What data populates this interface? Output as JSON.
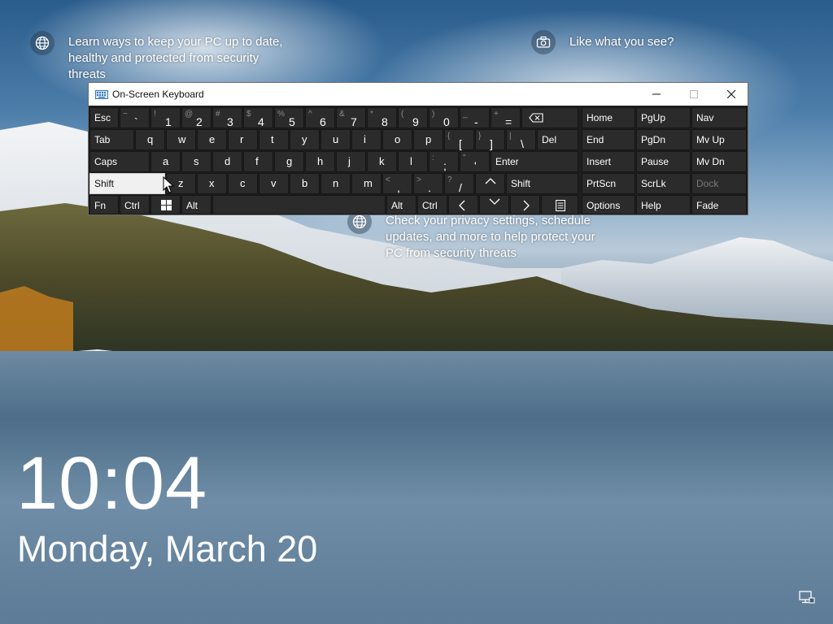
{
  "notifications": [
    {
      "icon": "globe-icon",
      "text_lines": [
        "Learn ways to keep your PC up to date,",
        "healthy and protected from security",
        "threats"
      ]
    },
    {
      "icon": "camera-icon",
      "text_lines": [
        "Like what you see?"
      ]
    },
    {
      "icon": "globe-icon",
      "text_lines": [
        "Check your privacy settings, schedule",
        "updates, and more to help protect your",
        "PC from security threats"
      ]
    }
  ],
  "lock_screen": {
    "time": "10:04",
    "date": "Monday, March 20"
  },
  "osk": {
    "title": "On-Screen Keyboard",
    "rows": [
      [
        {
          "label": "Esc"
        },
        {
          "shift": "~",
          "base": "`"
        },
        {
          "shift": "!",
          "base": "1"
        },
        {
          "shift": "@",
          "base": "2"
        },
        {
          "shift": "#",
          "base": "3"
        },
        {
          "shift": "$",
          "base": "4"
        },
        {
          "shift": "%",
          "base": "5"
        },
        {
          "shift": "^",
          "base": "6"
        },
        {
          "shift": "&",
          "base": "7"
        },
        {
          "shift": "*",
          "base": "8"
        },
        {
          "shift": "(",
          "base": "9"
        },
        {
          "shift": ")",
          "base": "0"
        },
        {
          "shift": "_",
          "base": "-"
        },
        {
          "shift": "+",
          "base": "="
        },
        {
          "icon": "backspace-icon"
        }
      ],
      [
        {
          "label": "Tab"
        },
        {
          "label": "q"
        },
        {
          "label": "w"
        },
        {
          "label": "e"
        },
        {
          "label": "r"
        },
        {
          "label": "t"
        },
        {
          "label": "y"
        },
        {
          "label": "u"
        },
        {
          "label": "i"
        },
        {
          "label": "o"
        },
        {
          "label": "p"
        },
        {
          "shift": "{",
          "base": "["
        },
        {
          "shift": "}",
          "base": "]"
        },
        {
          "shift": "|",
          "base": "\\"
        },
        {
          "label": "Del"
        }
      ],
      [
        {
          "label": "Caps"
        },
        {
          "label": "a"
        },
        {
          "label": "s"
        },
        {
          "label": "d"
        },
        {
          "label": "f"
        },
        {
          "label": "g"
        },
        {
          "label": "h"
        },
        {
          "label": "j"
        },
        {
          "label": "k"
        },
        {
          "label": "l"
        },
        {
          "shift": ":",
          "base": ";"
        },
        {
          "shift": "\"",
          "base": "'"
        },
        {
          "label": "Enter"
        }
      ],
      [
        {
          "label": "Shift"
        },
        {
          "label": "z"
        },
        {
          "label": "x"
        },
        {
          "label": "c"
        },
        {
          "label": "v"
        },
        {
          "label": "b"
        },
        {
          "label": "n"
        },
        {
          "label": "m"
        },
        {
          "shift": "<",
          "base": ","
        },
        {
          "shift": ">",
          "base": "."
        },
        {
          "shift": "?",
          "base": "/"
        },
        {
          "icon": "arrow-up-icon"
        },
        {
          "label": "Shift"
        }
      ],
      [
        {
          "label": "Fn"
        },
        {
          "label": "Ctrl"
        },
        {
          "icon": "windows-icon"
        },
        {
          "label": "Alt"
        },
        {
          "label": ""
        },
        {
          "label": "Alt"
        },
        {
          "label": "Ctrl"
        },
        {
          "icon": "arrow-left-icon"
        },
        {
          "icon": "arrow-down-icon"
        },
        {
          "icon": "arrow-right-icon"
        },
        {
          "icon": "menu-icon"
        }
      ]
    ],
    "nav_keys": [
      [
        "Home",
        "PgUp",
        "Nav"
      ],
      [
        "End",
        "PgDn",
        "Mv Up"
      ],
      [
        "Insert",
        "Pause",
        "Mv Dn"
      ],
      [
        "PrtScn",
        "ScrLk",
        "Dock"
      ],
      [
        "Options",
        "Help",
        "Fade"
      ]
    ],
    "pressed_key": "Shift",
    "disabled_keys": [
      "Dock"
    ]
  },
  "colors": {
    "osk_bg": "#1f1f1f",
    "key_bg": "#2b2b2b",
    "key_pressed": "#f0f0f0",
    "text": "#ffffff"
  }
}
